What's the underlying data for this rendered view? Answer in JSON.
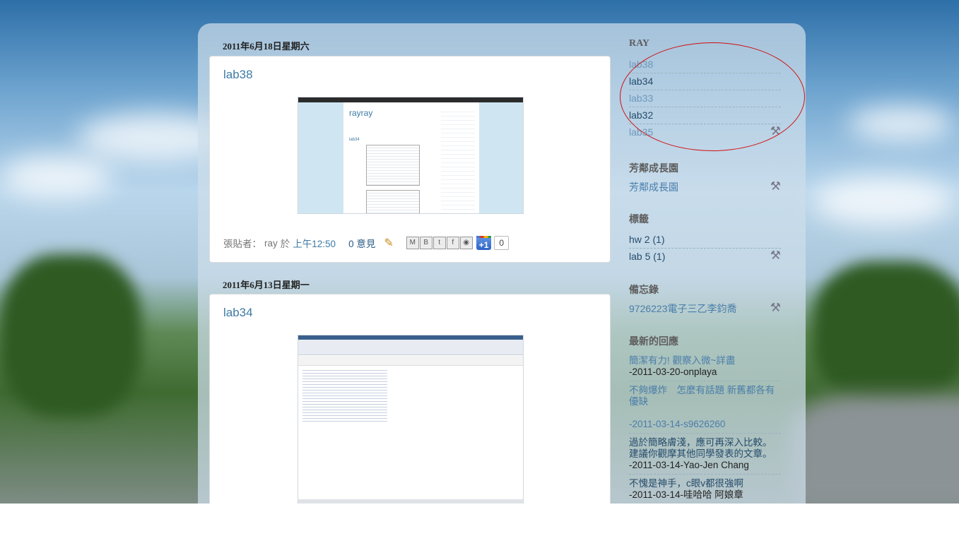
{
  "posts": [
    {
      "date": "2011年6月18日星期六",
      "title": "lab38",
      "footer": {
        "posted_by_prefix": "張貼者：",
        "author": "ray",
        "at": "於",
        "time": "上午12:50",
        "comments": "0 意見",
        "plusone_label": "+1",
        "plusone_count": "0"
      },
      "screenshot": {
        "blog_title": "rayray",
        "post_label": "lab34"
      }
    },
    {
      "date": "2011年6月13日星期一",
      "title": "lab34"
    }
  ],
  "share_icons": [
    "email-icon",
    "blogger-icon",
    "twitter-icon",
    "facebook-icon",
    "buzz-icon"
  ],
  "sidebar": {
    "ray": {
      "heading": "RAY",
      "items": [
        "lab38",
        "lab34",
        "lab33",
        "lab32",
        "lab35"
      ]
    },
    "garden": {
      "heading": "芳鄰成長園",
      "items": [
        "芳鄰成長園"
      ]
    },
    "labels": {
      "heading": "標籤",
      "items": [
        "hw 2 (1)",
        "lab 5 (1)"
      ]
    },
    "memo": {
      "heading": "備忘錄",
      "items": [
        "9726223電子三乙李鈞喬"
      ]
    },
    "recent_comments": {
      "heading": "最新的回應",
      "items": [
        {
          "text": "簡潔有力! 觀察入微~詳盡",
          "meta": "-2011-03-20-onplaya"
        },
        {
          "text": "不夠爆炸　怎麼有話題 新舊都各有優缺",
          "meta": "-2011-03-14-s9626260"
        },
        {
          "text": "過於簡略膚淺，應可再深入比較。建議你觀摩其他同學發表的文章。",
          "meta": "-2011-03-14-Yao-Jen Chang"
        },
        {
          "text": "不愧是神手，c眼v都很強啊",
          "meta": "-2011-03-14-哇哈哈 阿娘章"
        }
      ]
    }
  },
  "colors": {
    "link": "#3e7aa3",
    "annotation_circle": "#d10f0f"
  }
}
